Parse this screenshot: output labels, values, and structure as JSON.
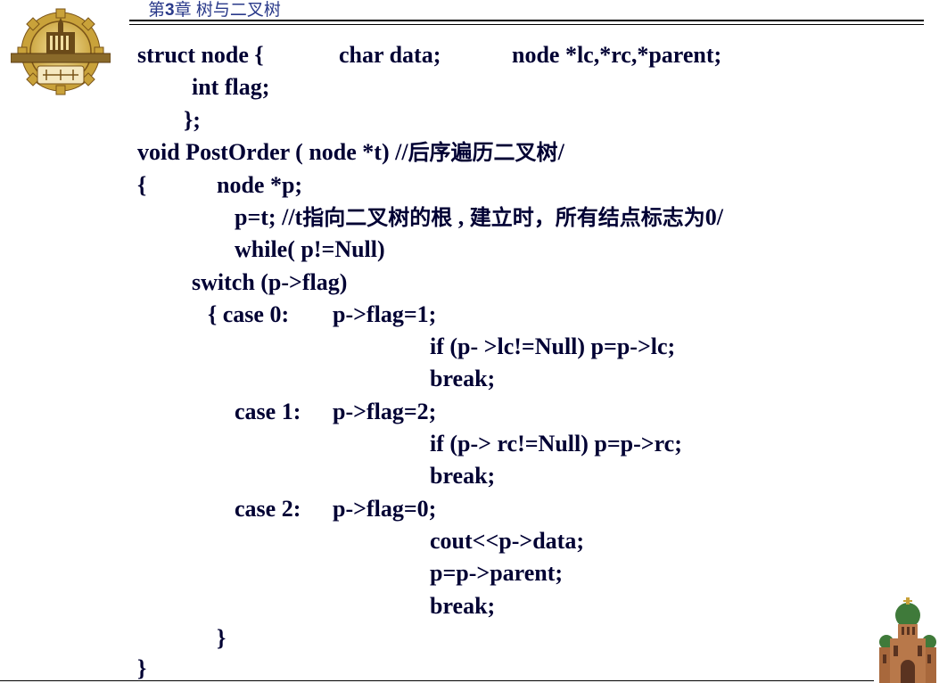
{
  "header": {
    "chapter_prefix": "第",
    "chapter_num": "3",
    "chapter_title": "章 树与二叉树"
  },
  "code": {
    "line1a": "struct node {",
    "line1b": "char data;",
    "line1c": "node *lc,*rc,*parent;",
    "line2": "int flag;",
    "line3": "};",
    "line4a": "void PostOrder ( node *t) //",
    "line4b": "后序遍历二叉树",
    "line4c": "/",
    "line5a": "{",
    "line5b": "node *p;",
    "line6a": "p=t;  //t",
    "line6b": "指向二叉树的根",
    "line6c": " , ",
    "line6d": "建立时，所有结点标志为",
    "line6e": "0/",
    "line7": "while( p!=Null)",
    "line8": "switch (p->flag)",
    "line9a": "{  case 0:",
    "line9b": "p->flag=1;",
    "line10": "if (p- >lc!=Null) p=p->lc;",
    "line11": "break;",
    "line12a": "case 1:",
    "line12b": "p->flag=2;",
    "line13": "if (p-> rc!=Null) p=p->rc;",
    "line14": "break;",
    "line15a": "case 2:",
    "line15b": "p->flag=0;",
    "line16": "cout<<p->data;",
    "line17": "p=p->parent;",
    "line18": "break;",
    "line19": "}",
    "line20": "}"
  },
  "colors": {
    "chapter_text": "#2a3a8a",
    "code_text": "#000033",
    "logo_gold": "#c9a23a",
    "logo_dark": "#5a3a10"
  }
}
